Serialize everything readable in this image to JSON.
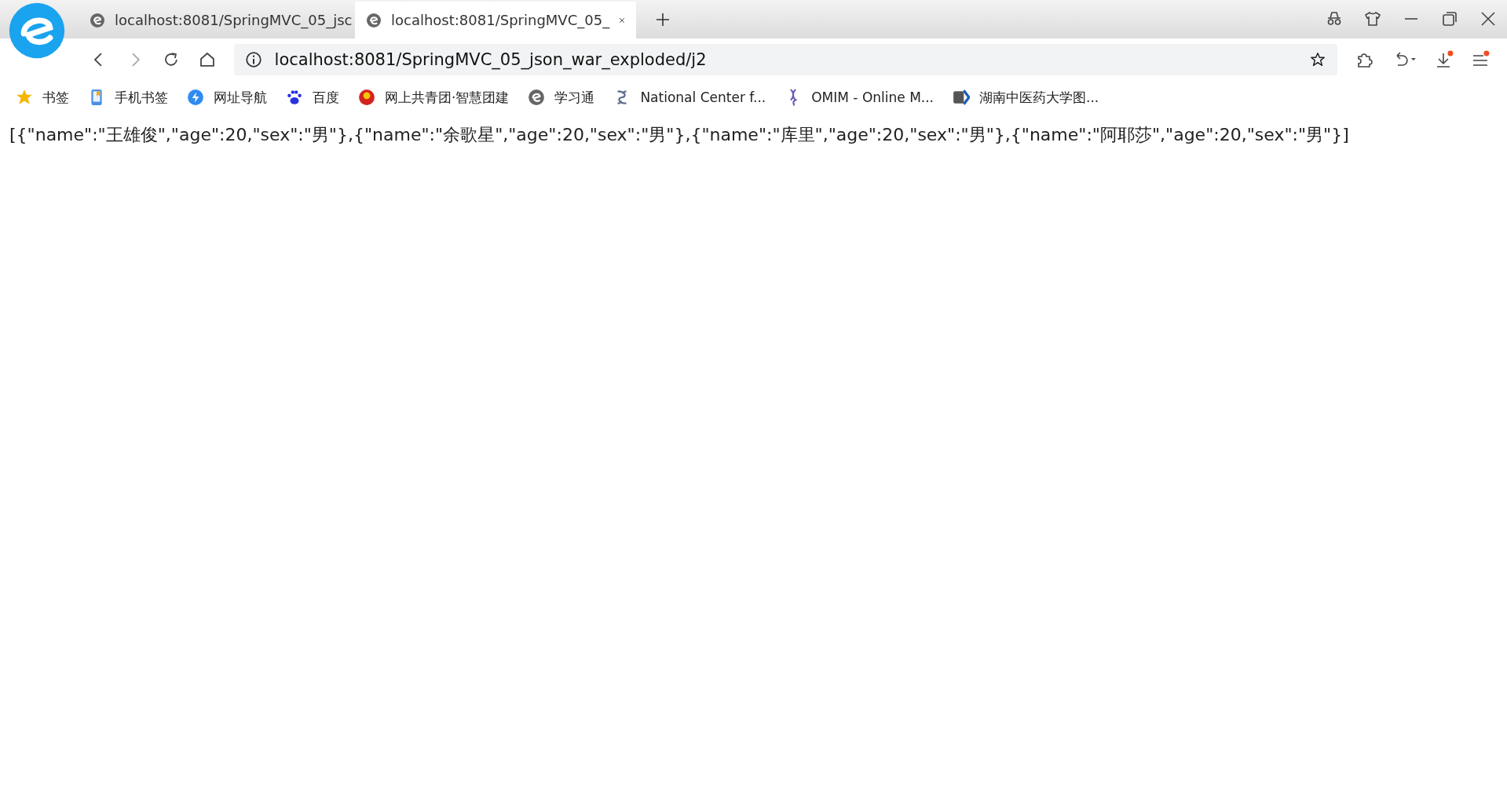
{
  "tabs": [
    {
      "title": "localhost:8081/SpringMVC_05_jsc",
      "selected": false
    },
    {
      "title": "localhost:8081/SpringMVC_05_",
      "selected": true
    }
  ],
  "address": {
    "value": "localhost:8081/SpringMVC_05_json_war_exploded/j2"
  },
  "bookmarks": [
    {
      "kind": "star",
      "label": "书签"
    },
    {
      "kind": "phone",
      "label": "手机书签"
    },
    {
      "kind": "nav",
      "label": "网址导航"
    },
    {
      "kind": "paw",
      "label": "百度"
    },
    {
      "kind": "emblem",
      "label": "网上共青团·智慧团建"
    },
    {
      "kind": "e",
      "label": "学习通"
    },
    {
      "kind": "helix",
      "label": "National Center f..."
    },
    {
      "kind": "dna",
      "label": "OMIM - Online M..."
    },
    {
      "kind": "chevron",
      "label": "湖南中医药大学图..."
    }
  ],
  "page": {
    "body_text": "[{\"name\":\"王雄俊\",\"age\":20,\"sex\":\"男\"},{\"name\":\"余歌星\",\"age\":20,\"sex\":\"男\"},{\"name\":\"库里\",\"age\":20,\"sex\":\"男\"},{\"name\":\"阿耶莎\",\"age\":20,\"sex\":\"男\"}]"
  }
}
